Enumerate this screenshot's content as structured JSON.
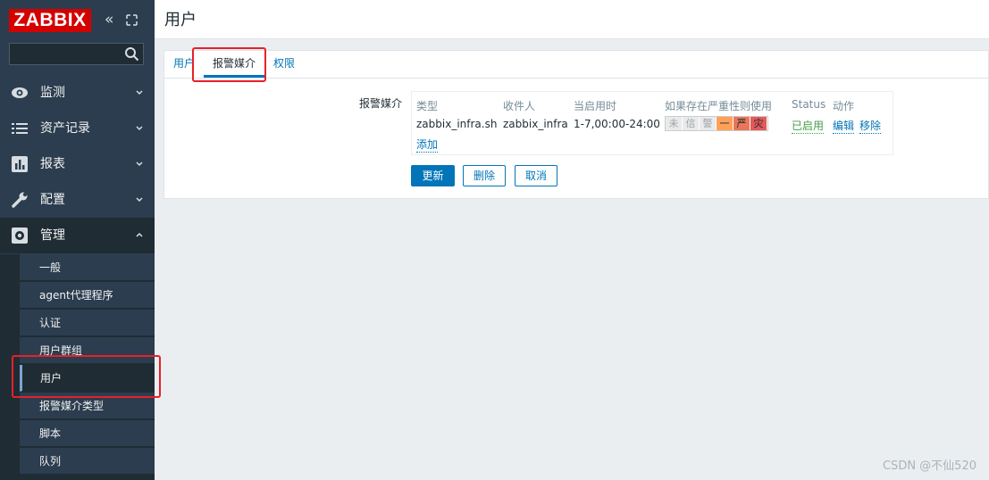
{
  "app": {
    "logo": "ZABBIX"
  },
  "sidebar": {
    "search_placeholder": "",
    "menu": [
      {
        "label": "监测",
        "icon": "eye-icon"
      },
      {
        "label": "资产记录",
        "icon": "list-icon"
      },
      {
        "label": "报表",
        "icon": "bar-chart-icon"
      },
      {
        "label": "配置",
        "icon": "wrench-icon"
      },
      {
        "label": "管理",
        "icon": "gear-icon"
      }
    ],
    "submenu": [
      {
        "label": "一般"
      },
      {
        "label": "agent代理程序"
      },
      {
        "label": "认证"
      },
      {
        "label": "用户群组"
      },
      {
        "label": "用户"
      },
      {
        "label": "报警媒介类型"
      },
      {
        "label": "脚本"
      },
      {
        "label": "队列"
      }
    ]
  },
  "page": {
    "title": "用户",
    "tabs": [
      {
        "label": "用户"
      },
      {
        "label": "报警媒介"
      },
      {
        "label": "权限"
      }
    ],
    "field_label": "报警媒介",
    "media_table": {
      "headers": [
        "类型",
        "收件人",
        "当启用时",
        "如果存在严重性则使用",
        "Status",
        "动作"
      ],
      "row": {
        "type": "zabbix_infra.sh",
        "recipient": "zabbix_infra",
        "when_active": "1-7,00:00-24:00",
        "severities": [
          "未",
          "信",
          "警",
          "一",
          "严",
          "灾"
        ],
        "severity_colors": [
          "#eaeaea",
          "#eaeaea",
          "#eaeaea",
          "#ffa059",
          "#e97659",
          "#e45959"
        ],
        "status": "已启用",
        "action_edit": "编辑",
        "action_remove": "移除"
      },
      "add_label": "添加"
    },
    "buttons": {
      "update": "更新",
      "delete": "删除",
      "cancel": "取消"
    }
  },
  "watermark": "CSDN @不仙520",
  "colors": {
    "sidebar": "#2b3d4f",
    "accent": "#0275b8",
    "logo": "#d40000",
    "highlight": "#e8202a"
  }
}
